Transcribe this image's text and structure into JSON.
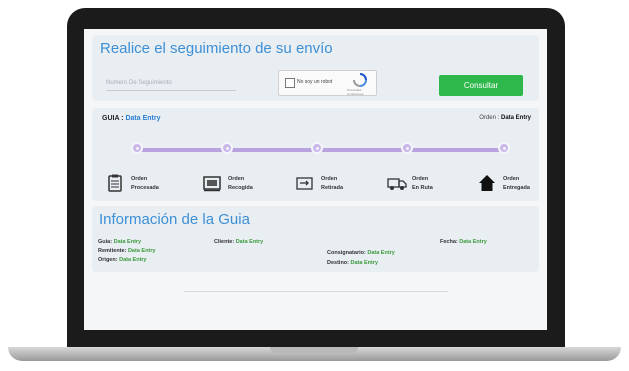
{
  "tracking": {
    "title": "Realice el seguimiento de su envío",
    "input_placeholder": "Numero De Seguimiento",
    "captcha_text": "No soy un robot",
    "captcha_legal": "Privacidad - Condiciones",
    "button": "Consultar"
  },
  "guide": {
    "label": "GUIA :",
    "value": "Data Entry",
    "order_label": "Orden :",
    "order_value": "Data Entry"
  },
  "steps": [
    {
      "line1": "Orden",
      "line2": "Procesada",
      "icon": "clipboard-icon"
    },
    {
      "line1": "Orden",
      "line2": "Recogida",
      "icon": "package-icon"
    },
    {
      "line1": "Orden",
      "line2": "Retirada",
      "icon": "box-arrow-icon"
    },
    {
      "line1": "Orden",
      "line2": "En Ruta",
      "icon": "truck-icon"
    },
    {
      "line1": "Orden",
      "line2": "Entregada",
      "icon": "home-icon"
    }
  ],
  "info": {
    "title": "Información de la Guia",
    "guia": {
      "label": "Guia:",
      "value": "Data Entry"
    },
    "cliente": {
      "label": "Cliente:",
      "value": "Data Entry"
    },
    "fecha": {
      "label": "Fecha:",
      "value": "Data Entry"
    },
    "remitente": {
      "label": "Remitente:",
      "value": "Data Entry"
    },
    "consignatario": {
      "label": "Consignatario:",
      "value": "Data Entry"
    },
    "origen": {
      "label": "Origen:",
      "value": "Data Entry"
    },
    "destino": {
      "label": "Destino:",
      "value": "Data Entry"
    }
  },
  "colors": {
    "accent": "#3d8fd6",
    "button": "#2eb84b",
    "timeline": "#b9a2dd",
    "value_green": "#3a9a3a"
  }
}
